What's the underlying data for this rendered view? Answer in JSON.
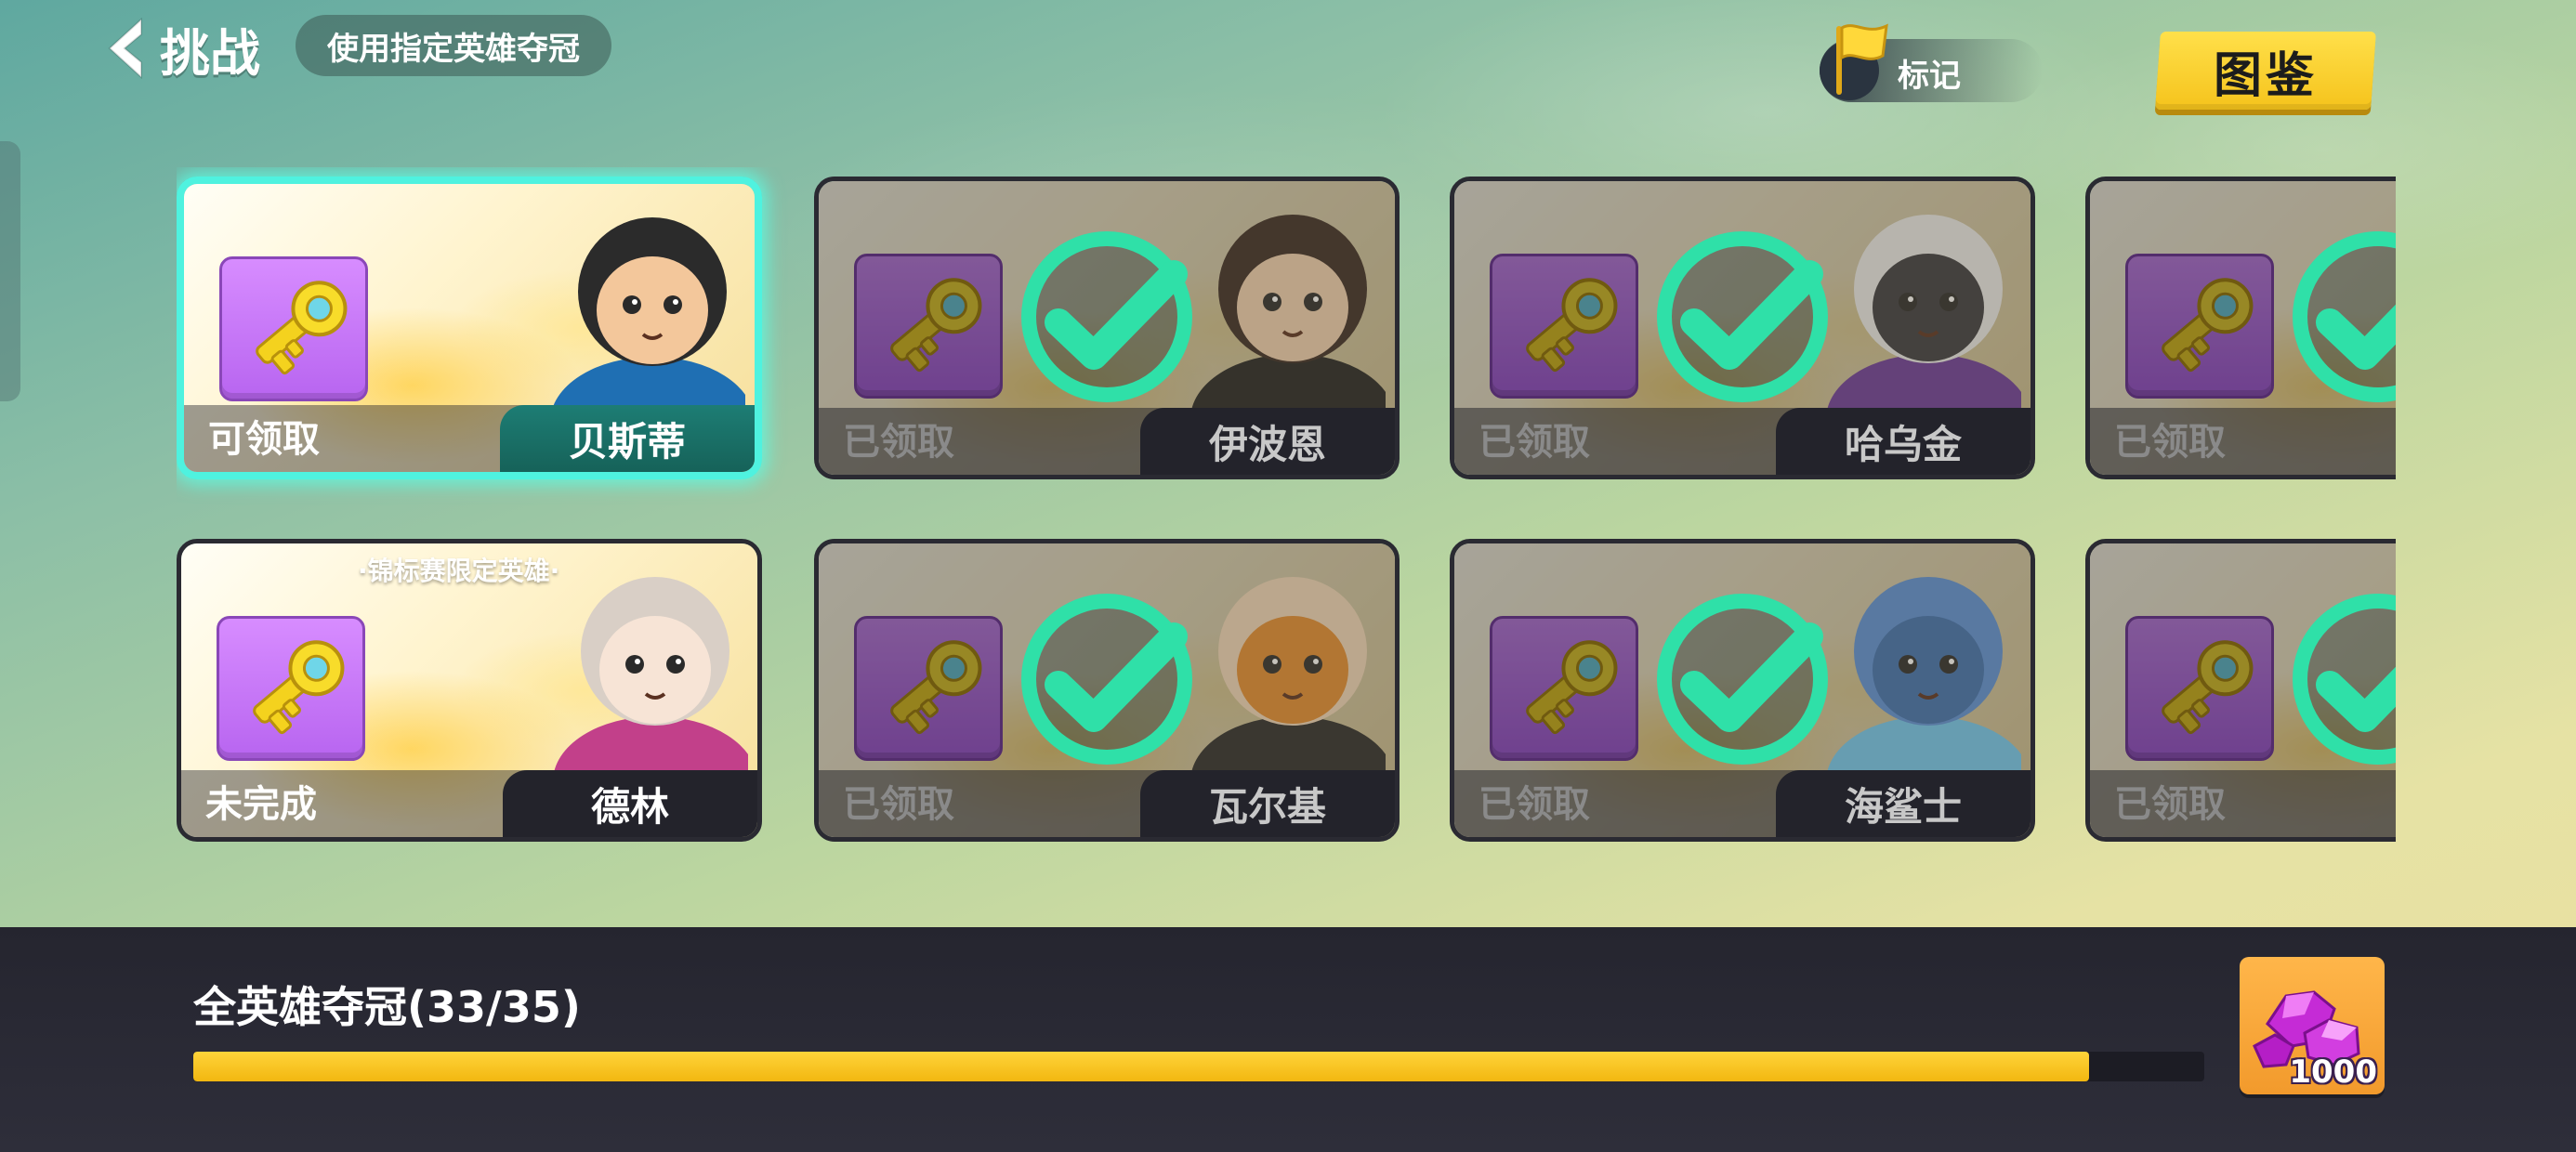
{
  "header": {
    "back_title": "挑战",
    "subtitle": "使用指定英雄夺冠",
    "mark_label": "标记",
    "atlas_label": "图鉴"
  },
  "cards": [
    {
      "status": "可领取",
      "name": "贝斯蒂",
      "state": "claimable",
      "tag": ""
    },
    {
      "status": "已领取",
      "name": "伊波恩",
      "state": "claimed",
      "tag": ""
    },
    {
      "status": "已领取",
      "name": "哈乌金",
      "state": "claimed",
      "tag": ""
    },
    {
      "status": "已领取",
      "name": "",
      "state": "claimed",
      "tag": ""
    },
    {
      "status": "未完成",
      "name": "德林",
      "state": "incomplete",
      "tag": "·锦标赛限定英雄·"
    },
    {
      "status": "已领取",
      "name": "瓦尔基",
      "state": "claimed",
      "tag": ""
    },
    {
      "status": "已领取",
      "name": "海鲨士",
      "state": "claimed",
      "tag": ""
    },
    {
      "status": "已领取",
      "name": "",
      "state": "claimed",
      "tag": ""
    }
  ],
  "progress": {
    "label": "全英雄夺冠(33/35)",
    "current": 33,
    "total": 35,
    "reward_quantity": "1000"
  },
  "colors": {
    "accent_cyan": "#4ff2df",
    "check_green": "#2fe0a8",
    "progress_yellow": "#ffd43a",
    "atlas_yellow": "#f5c31c",
    "key_purple": "#c678f5"
  },
  "icons": [
    "back-arrow-icon",
    "flag-icon",
    "key-icon",
    "checkmark-icon",
    "gem-icon"
  ]
}
